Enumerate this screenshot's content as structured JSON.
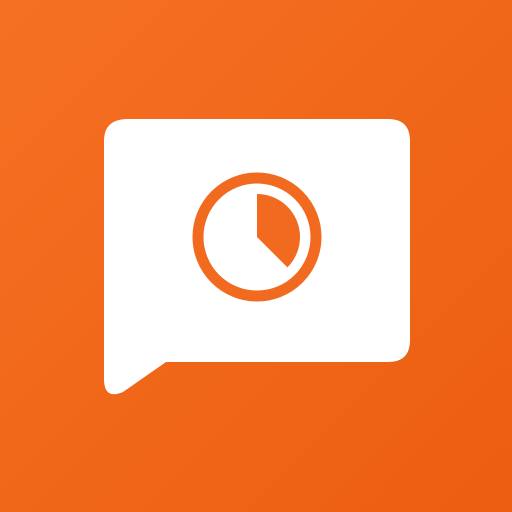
{
  "icon": {
    "name": "chat-timer-app-icon",
    "glyphs": [
      "speech-bubble-icon",
      "timer-icon"
    ]
  },
  "colors": {
    "background_start": "#F57023",
    "background_end": "#EC5E10",
    "bubble_fill": "#FFFFFF",
    "timer_stroke": "#F26A1F"
  },
  "timer": {
    "filled_fraction": 0.375
  }
}
